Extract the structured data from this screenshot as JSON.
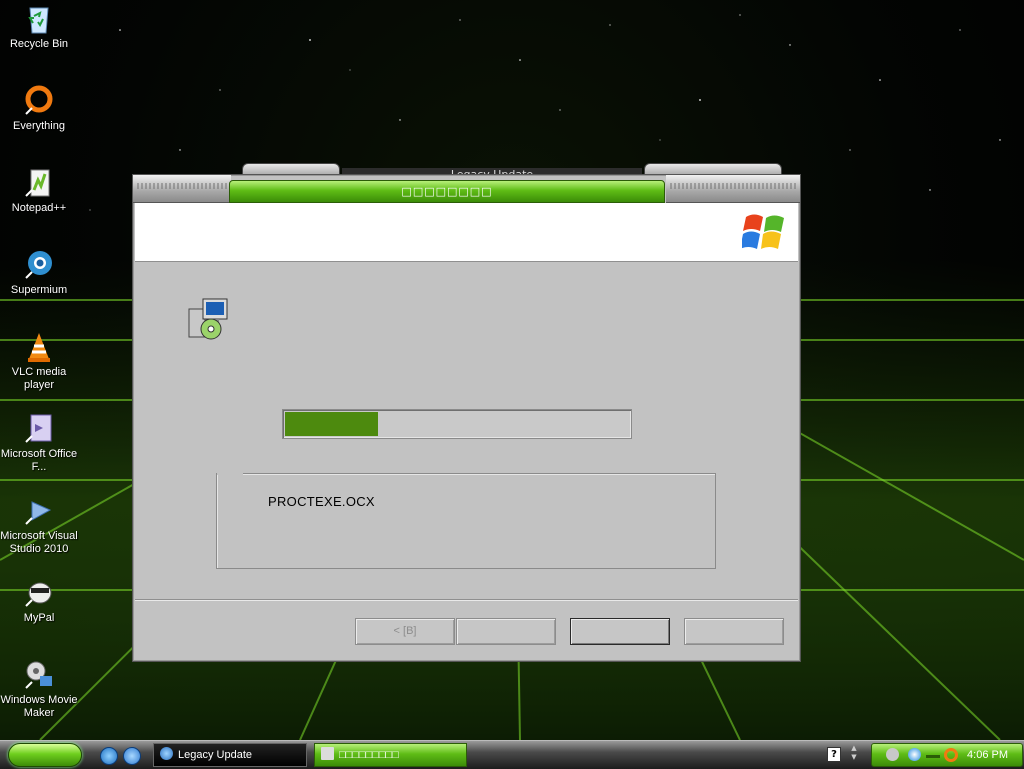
{
  "desktop": {
    "icons": [
      {
        "label": "Recycle Bin",
        "icon": "recycle-bin-icon"
      },
      {
        "label": "Everything",
        "icon": "everything-icon"
      },
      {
        "label": "Notepad++",
        "icon": "notepadpp-icon"
      },
      {
        "label": "Supermium",
        "icon": "supermium-icon"
      },
      {
        "label": "VLC media player",
        "icon": "vlc-icon"
      },
      {
        "label": "Microsoft Office F...",
        "icon": "office-icon"
      },
      {
        "label": "Microsoft Visual Studio 2010",
        "icon": "visual-studio-icon"
      },
      {
        "label": "MyPal",
        "icon": "mypal-icon"
      },
      {
        "label": "Windows Movie Maker",
        "icon": "movie-maker-icon"
      }
    ]
  },
  "background_window": {
    "title": "Legacy Update"
  },
  "dialog": {
    "title": "□□□□□□□□",
    "progress_fraction": 0.27,
    "current_file": "PROCTEXE.OCX",
    "buttons": {
      "back": "<   [B]",
      "next": "",
      "cancel": "",
      "help": ""
    }
  },
  "taskbar": {
    "tasks": [
      {
        "label": "Legacy Update",
        "icon": "legacy-update-icon"
      },
      {
        "label": "□□□□□□□□□",
        "icon": "setup-icon"
      }
    ],
    "help_icon_text": "?",
    "clock": "4:06 PM"
  },
  "colors": {
    "accent_green": "#5fbd16",
    "progress_green": "#4d8a0e",
    "dialog_gray": "#c2c2c2"
  }
}
